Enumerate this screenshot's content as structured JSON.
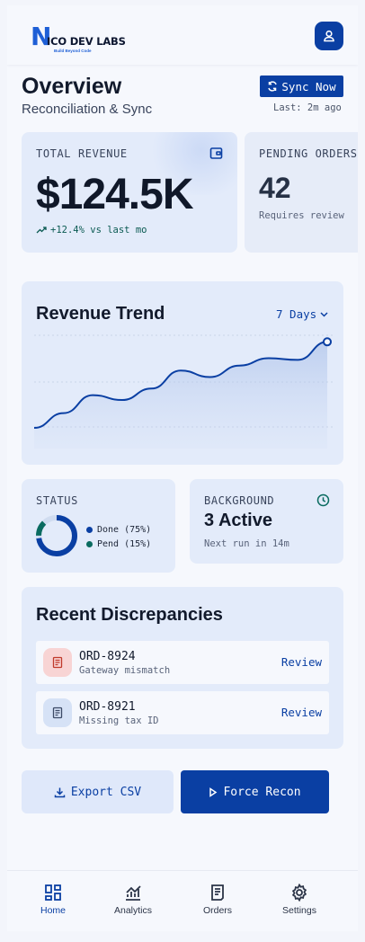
{
  "brand": {
    "logo_text": "ICO DEV LABS",
    "logo_tagline": "Build Beyond Code"
  },
  "header": {
    "profile_icon": "user-icon"
  },
  "overview": {
    "title": "Overview",
    "subtitle": "Reconciliation & Sync",
    "sync_button": "Sync Now",
    "last_sync": "Last: 2m ago"
  },
  "kpis": [
    {
      "label": "TOTAL REVENUE",
      "value": "$124.5K",
      "trend": "+12.4% vs last mo",
      "icon": "wallet-icon"
    },
    {
      "label": "PENDING ORDERS",
      "value": "42",
      "sub": "Requires review"
    }
  ],
  "revenue_trend": {
    "title": "Revenue Trend",
    "range_label": "7 Days",
    "accent": "#0a3fa3",
    "chart_data": {
      "type": "area",
      "points": [
        12,
        30,
        52,
        46,
        60,
        82,
        74,
        88,
        97,
        95,
        117
      ],
      "ylim": [
        0,
        125
      ],
      "grid": true,
      "highlight_last": true
    }
  },
  "status": {
    "label": "STATUS",
    "legend": [
      {
        "text": "Done (75%)",
        "color": "#0a3fa3"
      },
      {
        "text": "Pend (15%)",
        "color": "#0a6b60"
      }
    ],
    "done_fraction": 0.75,
    "pend_fraction": 0.15
  },
  "background": {
    "label": "BACKGROUND",
    "value": "3 Active",
    "sub": "Next run in 14m",
    "icon": "clock-icon"
  },
  "discrepancies": {
    "title": "Recent Discrepancies",
    "items": [
      {
        "id": "ORD-8924",
        "reason": "Gateway mismatch",
        "action": "Review",
        "icon": "receipt-icon",
        "tone": "#f8d4d4"
      },
      {
        "id": "ORD-8921",
        "reason": "Missing tax ID",
        "action": "Review",
        "icon": "receipt-icon",
        "tone": "#d6e2f6"
      }
    ]
  },
  "actions": {
    "export": "Export CSV",
    "force": "Force Recon"
  },
  "nav": [
    {
      "label": "Home",
      "icon": "home-grid-icon",
      "active": true
    },
    {
      "label": "Analytics",
      "icon": "analytics-icon",
      "active": false
    },
    {
      "label": "Orders",
      "icon": "orders-icon",
      "active": false
    },
    {
      "label": "Settings",
      "icon": "settings-gear-icon",
      "active": false
    }
  ]
}
